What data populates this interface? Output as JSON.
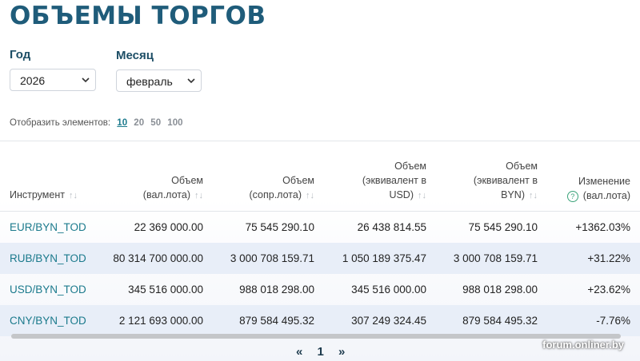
{
  "title": "ОБЪЕМЫ ТОРГОВ",
  "filters": {
    "year_label": "Год",
    "year_value": "2026",
    "month_label": "Месяц",
    "month_value": "февраль"
  },
  "perpage": {
    "label": "Отобразить элементов:",
    "options": [
      "10",
      "20",
      "50",
      "100"
    ],
    "active": "10"
  },
  "table": {
    "headers": [
      {
        "lines": [
          "Инструмент"
        ]
      },
      {
        "lines": [
          "Объем (вал.лота)"
        ]
      },
      {
        "lines": [
          "Объем",
          "(сопр.лота)"
        ]
      },
      {
        "lines": [
          "Объем",
          "(эквивалент в",
          "USD)"
        ]
      },
      {
        "lines": [
          "Объем",
          "(эквивалент в",
          "BYN)"
        ]
      },
      {
        "lines": [
          "Изменение",
          "(вал.лота)"
        ]
      }
    ],
    "rows": [
      {
        "instrument": "EUR/BYN_TOD",
        "vol_lot": "22 369 000.00",
        "vol_conj": "75 545 290.10",
        "vol_usd": "26 438 814.55",
        "vol_byn": "75 545 290.10",
        "change": "+1362.03%"
      },
      {
        "instrument": "RUB/BYN_TOD",
        "vol_lot": "80 314 700 000.00",
        "vol_conj": "3 000 708 159.71",
        "vol_usd": "1 050 189 375.47",
        "vol_byn": "3 000 708 159.71",
        "change": "+31.22%"
      },
      {
        "instrument": "USD/BYN_TOD",
        "vol_lot": "345 516 000.00",
        "vol_conj": "988 018 298.00",
        "vol_usd": "345 516 000.00",
        "vol_byn": "988 018 298.00",
        "change": "+23.62%"
      },
      {
        "instrument": "CNY/BYN_TOD",
        "vol_lot": "2 121 693 000.00",
        "vol_conj": "879 584 495.32",
        "vol_usd": "307 249 324.45",
        "vol_byn": "879 584 495.32",
        "change": "-7.76%"
      }
    ]
  },
  "pagination": {
    "prev": "«",
    "current": "1",
    "next": "»"
  },
  "watermark": "forum.onliner.by",
  "colors": {
    "accent": "#1f5c7a",
    "link": "#1b7a8c",
    "positive": "#2b9a6a",
    "negative": "#c0392b",
    "row_alt": "#e8eef8"
  },
  "icons": {
    "sort": "sort-arrows-icon",
    "help": "question-circle-icon",
    "dropdown": "chevron-down-icon"
  }
}
